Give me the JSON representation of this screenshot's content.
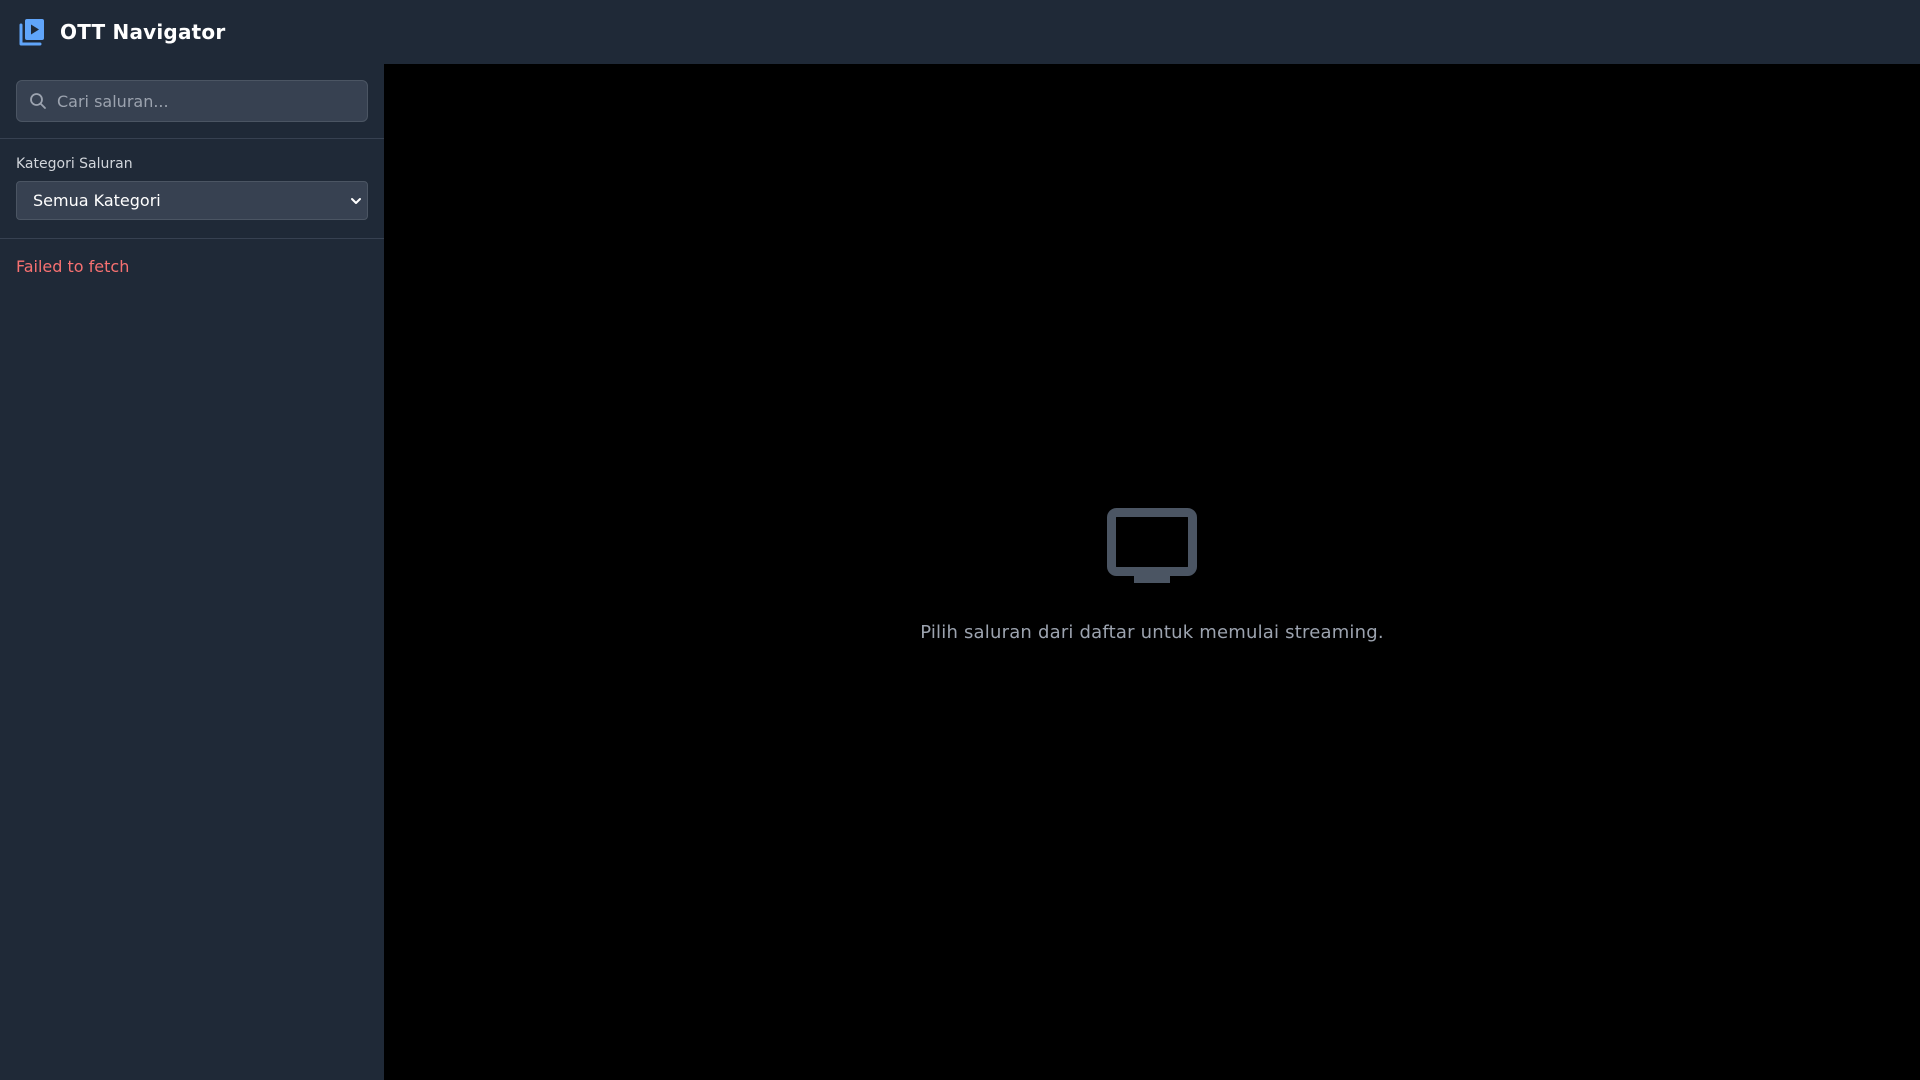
{
  "header": {
    "title": "OTT Navigator",
    "logo_icon": "play-library-icon",
    "logo_color": "#60a5fa"
  },
  "sidebar": {
    "search": {
      "placeholder": "Cari saluran...",
      "value": "",
      "icon": "search-icon"
    },
    "category": {
      "label": "Kategori Saluran",
      "selected": "Semua Kategori"
    },
    "error": {
      "message": "Failed to fetch",
      "color": "#f87171"
    }
  },
  "main": {
    "empty_state": {
      "icon": "tv-icon",
      "message": "Pilih saluran dari daftar untuk memulai streaming."
    }
  },
  "colors": {
    "panel_bg": "#1f2937",
    "input_bg": "#374151",
    "main_bg": "#000000"
  }
}
